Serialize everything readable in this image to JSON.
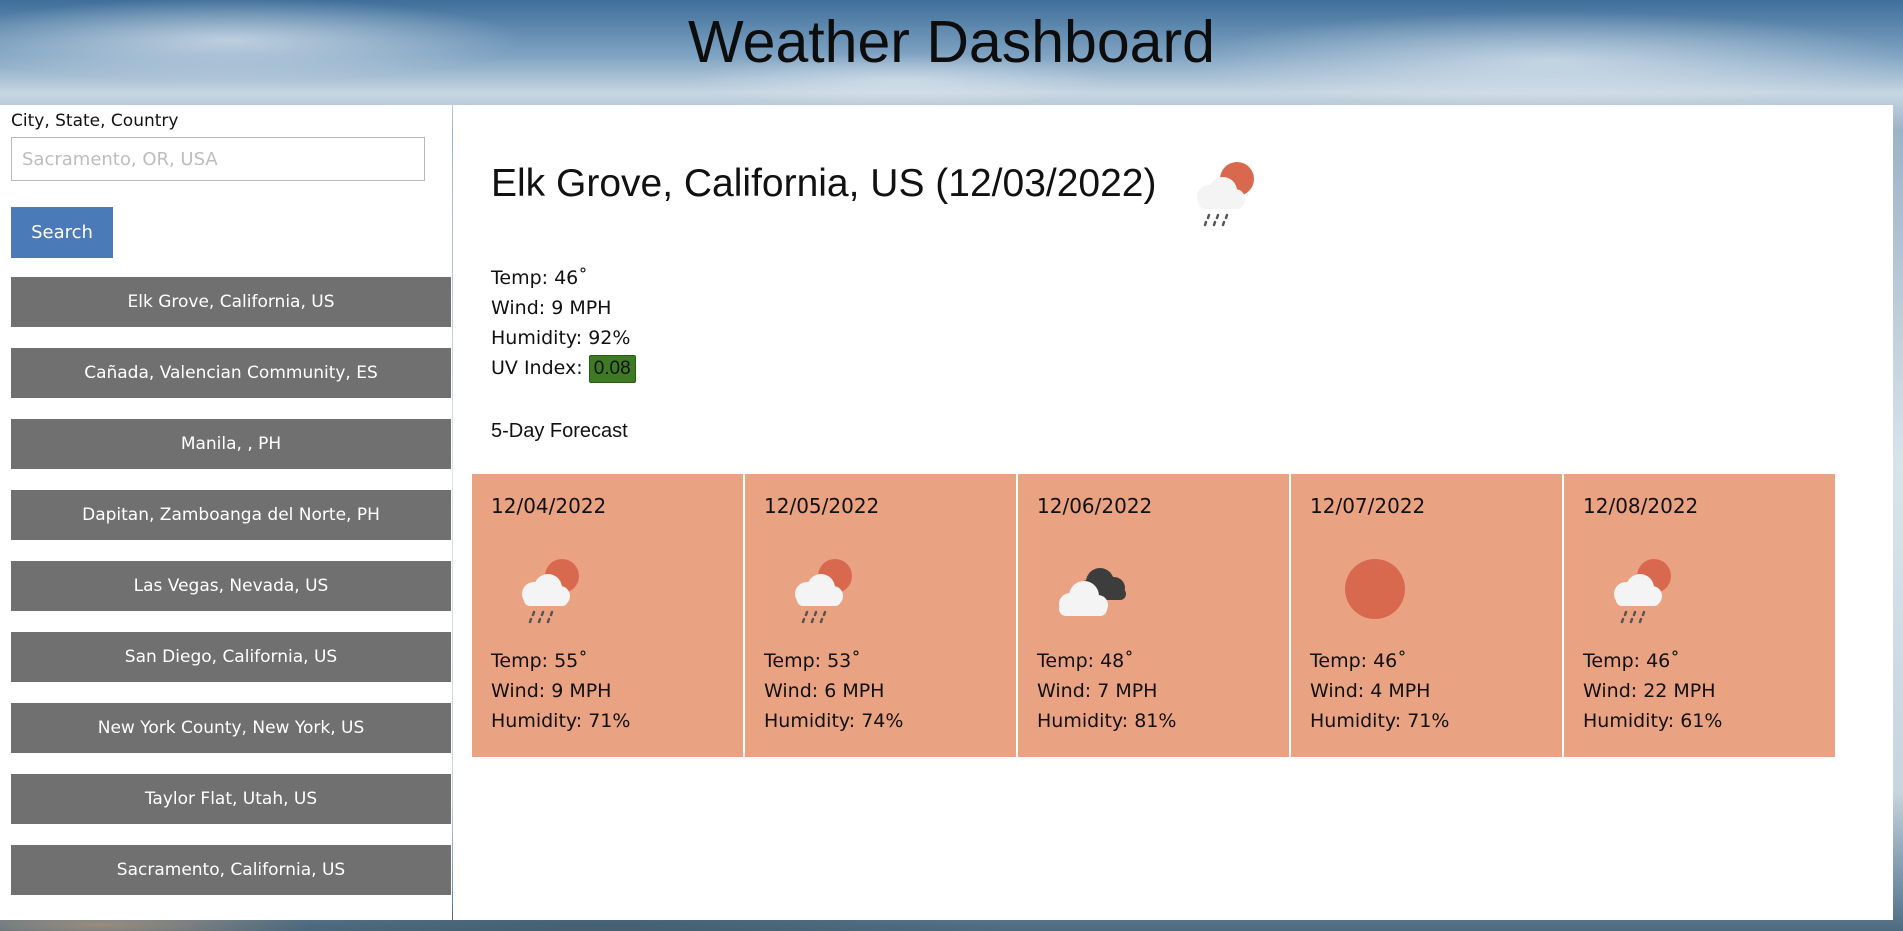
{
  "header": {
    "title": "Weather Dashboard"
  },
  "search": {
    "label": "City, State, Country",
    "placeholder": "Sacramento, OR, USA",
    "value": "",
    "button_label": "Search"
  },
  "history": [
    "Elk Grove, California, US",
    "Cañada, Valencian Community, ES",
    "Manila, , PH",
    "Dapitan, Zamboanga del Norte, PH",
    "Las Vegas, Nevada, US",
    "San Diego, California, US",
    "New York County, New York, US",
    "Taylor Flat, Utah, US",
    "Sacramento, California, US"
  ],
  "current": {
    "title": "Elk Grove, California, US (12/03/2022)",
    "icon": "rain-cloud-sun-icon",
    "temp": "Temp: 46˚",
    "wind": "Wind: 9 MPH",
    "humidity": "Humidity: 92%",
    "uv_label": "UV Index: ",
    "uv_value": "0.08"
  },
  "forecast": {
    "title": "5-Day Forecast",
    "days": [
      {
        "date": "12/04/2022",
        "icon": "rain-cloud-sun-icon",
        "temp": "Temp: 55˚",
        "wind": "Wind: 9 MPH",
        "humidity": "Humidity: 71%"
      },
      {
        "date": "12/05/2022",
        "icon": "rain-cloud-sun-icon",
        "temp": "Temp: 53˚",
        "wind": "Wind: 6 MPH",
        "humidity": "Humidity: 74%"
      },
      {
        "date": "12/06/2022",
        "icon": "broken-clouds-icon",
        "temp": "Temp: 48˚",
        "wind": "Wind: 7 MPH",
        "humidity": "Humidity: 81%"
      },
      {
        "date": "12/07/2022",
        "icon": "sun-icon",
        "temp": "Temp: 46˚",
        "wind": "Wind: 4 MPH",
        "humidity": "Humidity: 71%"
      },
      {
        "date": "12/08/2022",
        "icon": "rain-cloud-sun-icon",
        "temp": "Temp: 46˚",
        "wind": "Wind: 22 MPH",
        "humidity": "Humidity: 61%"
      }
    ]
  },
  "colors": {
    "search_button": "#4a7ab8",
    "history_button": "#707070",
    "forecast_card": "#e9a282",
    "uv_favorable": "#3e7a23"
  }
}
